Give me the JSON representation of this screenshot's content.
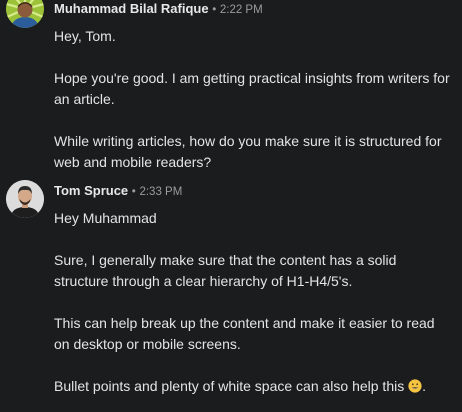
{
  "messages": [
    {
      "author": "Muhammad Bilal Rafique",
      "separator": "•",
      "time": "2:22 PM",
      "avatar_icon": "user-avatar-mbr",
      "paragraphs": [
        "Hey, Tom.",
        "Hope you're good. I am getting practical insights from writers for an article.",
        "While writing articles, how do you make sure it is structured for web and mobile readers?"
      ]
    },
    {
      "author": "Tom Spruce",
      "separator": "•",
      "time": "2:33 PM",
      "avatar_icon": "user-avatar-ts",
      "paragraphs": [
        "Hey Muhammad",
        "Sure, I generally make sure that the content has a solid structure through a clear hierarchy of H1-H4/5's.",
        "This can help break up the content and make it easier to read on desktop or mobile screens.",
        "Bullet points and plenty of white space can also help this"
      ],
      "trailing_emoji": "grinning-face-emoji",
      "trailing_text": "."
    }
  ],
  "colors": {
    "background": "#1b1c1e",
    "text": "#e4e4e4",
    "meta": "#9b9b9b"
  }
}
